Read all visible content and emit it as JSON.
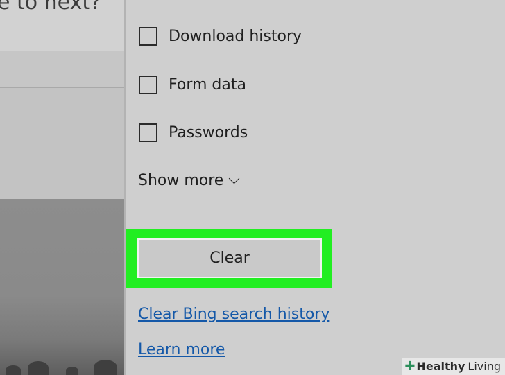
{
  "background_page": {
    "heading_fragment": "e to next?"
  },
  "clear_browsing_panel": {
    "checkboxes": [
      {
        "label": "Download history",
        "checked": false
      },
      {
        "label": "Form data",
        "checked": false
      },
      {
        "label": "Passwords",
        "checked": false
      }
    ],
    "show_more_label": "Show more",
    "clear_button_label": "Clear",
    "links": {
      "clear_bing": "Clear Bing search history",
      "learn_more": "Learn more"
    }
  },
  "watermark": {
    "brand_bold": "Healthy",
    "brand_light": "Living"
  },
  "colors": {
    "highlight": "#22ee22",
    "link": "#1458a8",
    "panel_bg": "#cfcfcf"
  }
}
